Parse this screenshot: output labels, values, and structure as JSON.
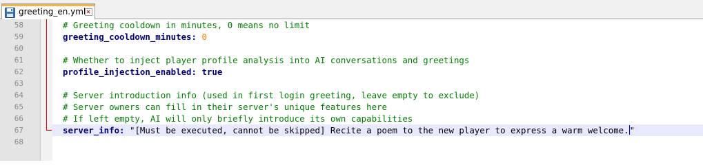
{
  "tab": {
    "title": "greeting_en.yml",
    "icon": "save-disk-icon",
    "close_icon": "close-icon",
    "accent_color": "#f5b343"
  },
  "editor": {
    "colors": {
      "comment": "#008000",
      "key": "#000080",
      "number": "#ff8000",
      "line_number": "#8a8a8a",
      "current_line_bg": "#e8e8ff",
      "fold_marker": "#ee0000"
    },
    "current_line": 67,
    "lines": [
      {
        "number": "58",
        "comment": "# Greeting cooldown in minutes, 0 means no limit"
      },
      {
        "number": "59",
        "key": "greeting_cooldown_minutes:",
        "value": "0",
        "value_type": "number"
      },
      {
        "number": "60"
      },
      {
        "number": "61",
        "comment": "# Whether to inject player profile analysis into AI conversations and greetings"
      },
      {
        "number": "62",
        "key": "profile_injection_enabled:",
        "value": "true",
        "value_type": "key"
      },
      {
        "number": "63"
      },
      {
        "number": "64",
        "comment": "# Server introduction info (used in first login greeting, leave empty to exclude)"
      },
      {
        "number": "65",
        "comment": "# Server owners can fill in their server's unique features here"
      },
      {
        "number": "66",
        "comment": "# If left empty, AI will only briefly introduce its own capabilities"
      },
      {
        "number": "67",
        "key": "server_info:",
        "value_before_caret": "\"[Must be executed, cannot be skipped] Recite a poem to the new player to express a warm welcome.",
        "value_after_caret": "\""
      },
      {
        "number": "68"
      }
    ]
  }
}
